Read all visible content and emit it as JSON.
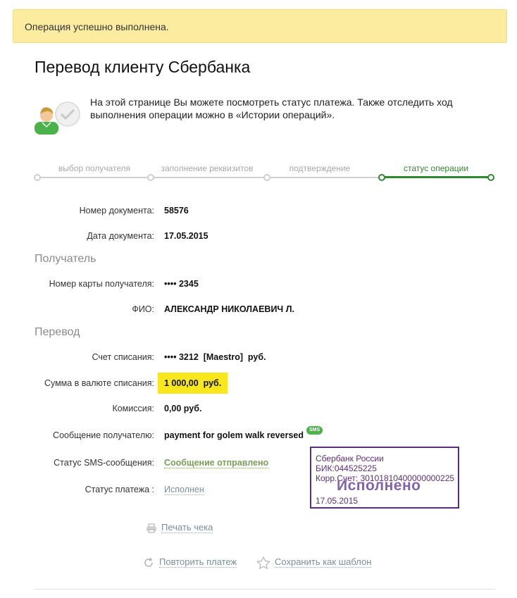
{
  "banner": {
    "text": "Операция успешно выполнена."
  },
  "page": {
    "title": "Перевод клиенту Сбербанка"
  },
  "intro": {
    "text": "На этой странице Вы можете посмотреть статус платежа. Также отследить ход выполнения операции можно в «Истории операций»."
  },
  "steps": [
    {
      "label": "выбор получателя",
      "active": false
    },
    {
      "label": "заполнение реквизитов",
      "active": false
    },
    {
      "label": "подтверждение",
      "active": false
    },
    {
      "label": "статус операции",
      "active": true
    }
  ],
  "document": {
    "number_label": "Номер документа:",
    "number": "58576",
    "date_label": "Дата документа:",
    "date": "17.05.2015"
  },
  "recipient": {
    "title": "Получатель",
    "card_label": "Номер карты получателя:",
    "card": "•••• 2345",
    "name_label": "ФИО:",
    "name": "АЛЕКСАНДР НИКОЛАЕВИЧ Л."
  },
  "transfer": {
    "title": "Перевод",
    "account_label": "Счет списания:",
    "account": "•••• 3212  [Maestro]  руб.",
    "amount_label": "Сумма в валюте списания:",
    "amount": "1 000,00  руб.",
    "fee_label": "Комиссия:",
    "fee": "0,00 руб.",
    "message_label": "Сообщение получателю:",
    "message": "payment for golem walk reversed",
    "sms_badge": "SMS",
    "sms_status_label": "Статус SMS-сообщения:",
    "sms_status": "Сообщение отправлено",
    "payment_status_label": "Статус платежа :",
    "payment_status": "Исполнен"
  },
  "stamp": {
    "bank": "Сбербанк России",
    "bik": "БИК:044525225",
    "corr": "Корр.Счет: 30101810400000000225",
    "status": "Исполнено",
    "date": "17.05.2015"
  },
  "actions": {
    "print": "Печать чека",
    "repeat": "Повторить платеж",
    "save_template": "Сохранить как шаблон"
  },
  "colors": {
    "accent": "#2f8a2f",
    "banner_bg": "#fbeca0",
    "highlight": "#f8e71c",
    "stamp": "#5c2d7a"
  }
}
